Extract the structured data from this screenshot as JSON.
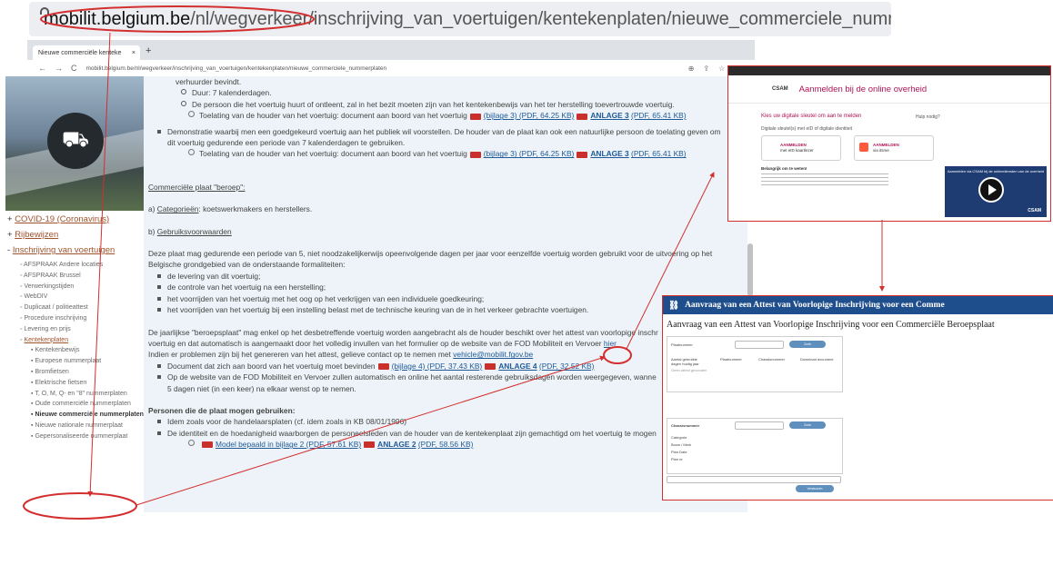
{
  "big_url": {
    "host": "mobilit.belgium.be",
    "path": "/nl/wegverkeer/inschrijving_van_voertuigen/kentekenplaten/nieuwe_commerciele_nummerplaten"
  },
  "browser": {
    "tab_title": "Nieuwe commerciële kenteke",
    "tab_close": "×",
    "new_tab": "+",
    "nav": [
      "←",
      "→",
      "C"
    ],
    "address": "mobilit.belgium.be/nl/wegverkeer/inschrijving_van_voertuigen/kentekenplaten/nieuwe_commerciele_nummerplaten",
    "ext_icons": [
      "⊕",
      "⇪",
      "☆",
      "✱"
    ]
  },
  "sidebar": {
    "top_items": [
      "COVID-19 (Coronavirus)",
      "Rijbewijzen",
      "Inschrijving van voertuigen"
    ],
    "sub_items": [
      "AFSPRAAK Andere locaties",
      "AFSPRAAK Brussel",
      "Verwerkingstijden",
      "WebDIV",
      "Duplicaat / politieattest",
      "Procedure inschrijving",
      "Levering en prijs",
      "Kentekenplaten"
    ],
    "plate_items": [
      "Kentekenbewijs",
      "Europese nummerplaat",
      "Bromfietsen",
      "Elektrische fietsen",
      "T, O, M, Q- en \"8\" nummerplaten",
      "Oude commerciële nummerplaten",
      "Nieuwe commerciële nummerplaten",
      "Nieuwe nationale nummerplaat",
      "Gepersonaliseerde nummerplaat"
    ]
  },
  "main": {
    "l1": "verhuurder bevindt.",
    "l2": "Duur: 7 kalenderdagen.",
    "l3": "De persoon die het voertuig huurt of ontleent, zal in het bezit moeten zijn van het kentekenbewijs van het ter herstelling toevertrouwde voertuig.",
    "l4a": "Toelating van de houder van het voertuig: document aan boord van het voertuig",
    "bijlage3": "(bijlage 3) (PDF, 64.25 KB)",
    "anlage3a": "ANLAGE 3",
    "anlage3b": "(PDF, 65.41 KB)",
    "l5": "Demonstratie waarbij men een goedgekeurd voertuig aan het publiek wil voorstellen. De houder van de plaat kan ook een natuurlijke persoon de toelating geven om",
    "l6": "dit voertuig gedurende een periode van 7 kalenderdagen te gebruiken.",
    "l7a": "Toelating van de houder van het voertuig: document aan boord van het voertuig",
    "heading": "Commerciële plaat \"beroep\":",
    "cat_prefix": "a)",
    "cat_link": "Categorieën",
    "cat_rest": ": koetswerkmakers en herstellers.",
    "gebr_prefix": "b)",
    "gebr_link": "Gebruiksvoorwaarden",
    "p1": "Deze plaat mag gedurende een periode van 5, niet noodzakelijkerwijs opeenvolgende dagen per jaar voor eenzelfde voertuig worden gebruikt voor de uitvoering op het",
    "p2": "Belgische grondgebied van de onderstaande formaliteiten:",
    "b1": "de levering van dit voertuig;",
    "b2": "de controle van het voertuig na een herstelling;",
    "b3": "het voorrijden van het voertuig met het oog op het verkrijgen van een individuele goedkeuring;",
    "b4": "het voorrijden van het voertuig bij een instelling belast met de technische keuring van de in het verkeer gebrachte voertuigen.",
    "q1": "De jaarlijkse \"beroepsplaat\" mag enkel op het desbetreffende voertuig worden aangebracht als de houder beschikt over het attest van voorlopige inschr",
    "q2a": "voertuig en dat automatisch is aangemaakt door het volledig invullen van het formulier op de website van de FOD Mobiliteit en Vervoer",
    "q2link": "hier",
    "q3a": "Indien er problemen zijn bij het genereren van het attest, gelieve contact op te nemen met",
    "email": "vehicle@mobilit.fgov.be",
    "d1a": "Document dat zich aan boord van het voertuig moet bevinden",
    "bijlage4": "(bijlage 4) (PDF, 37.43 KB)",
    "anlage4a": "ANLAGE 4",
    "anlage4b": "(PDF, 32.52 KB)",
    "d2": "Op de website van de FOD Mobiliteit en Vervoer zullen automatisch en online het aantal resterende gebruiksdagen worden weergegeven, wanne",
    "d3": "5 dagen niet (in een keer) na elkaar wenst op te nemen.",
    "persons": "Personen die de plaat mogen gebruiken:",
    "pe1": "Idem zoals voor de handelaarsplaten (cf. idem zoals in KB 08/01/1996)",
    "pe2": "De identiteit en de hoedanigheid waarborgen de personeelsleden van de houder van de kentekenplaat zijn gemachtigd om het voertuig te mogen",
    "model": "Model bepaald in bijlage 2 (PDF, 57.61 KB)",
    "anlage2a": "ANLAGE 2",
    "anlage2b": "(PDF, 58.56 KB)"
  },
  "csam": {
    "logo": "CSAM",
    "title": "Aanmelden bij de online overheid",
    "choose": "Kies uw digitale sleutel om aan te melden",
    "help": "Hulp nodig?",
    "sub": "Digitale sleutel(s) met eID of digitale identiteit",
    "card1a": "AANMELDEN",
    "card1b": "met eID kaartlezer",
    "card2a": "AANMELDEN",
    "card2b": "via itsme",
    "important": "Belangrijk om te weten!",
    "video_title": "Aanmelden via CSAM bij de onlinediensten van de overheid",
    "video_logo": "CSAM"
  },
  "form": {
    "bar_title": "Aanvraag van een Attest van Voorlopige Inschrijving voor een Comme",
    "heading": "Aanvraag van een Attest van Voorlopige Inschrijving voor een Commerciële Beroepsplaat",
    "plate_label": "Plaatnummer",
    "btn1": "Zoek",
    "cols": [
      "Aantal gebruikte dagen huidig jaar",
      "Plaatnummer",
      "Chassisnummer",
      "Download document"
    ],
    "no_data": "Geen attest gevonden",
    "chassis_label": "Chassisnummer",
    "btn2": "Zoek",
    "rows": [
      "Categorie",
      "Bouw / Merk",
      "Plan Date",
      "Plan nr"
    ],
    "submit": "Verstuuren"
  },
  "colors": {
    "accent_red": "#d32f2f",
    "link": "#1f5a97",
    "sidebar_link": "#a0522d",
    "form_bar": "#1f4e8c",
    "csam_title": "#ad1457"
  }
}
